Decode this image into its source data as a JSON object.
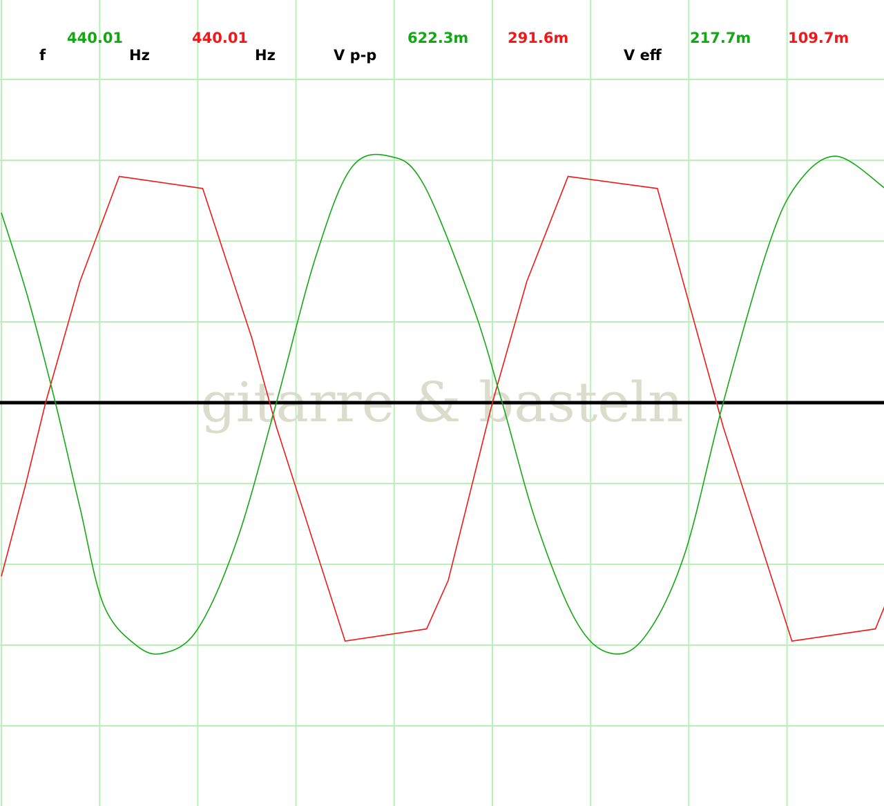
{
  "readouts": {
    "freq_label": "f",
    "freq_ch1": "440.01",
    "freq_unit_ch1": "Hz",
    "freq_ch2": "440.01",
    "freq_unit_ch2": "Hz",
    "vpp_label": "V p-p",
    "vpp_ch1": "622.3m",
    "vpp_ch2": "291.6m",
    "veff_label": "V eff",
    "veff_ch1": "217.7m",
    "veff_ch2": "109.7m"
  },
  "watermark": "gitarre & basteln",
  "colors": {
    "ch1": "#13a813",
    "ch2": "#f01818",
    "grid": "#b8f0b8",
    "zero_line": "#000000"
  },
  "chart_data": {
    "type": "line",
    "grid": true,
    "grid_divisions": {
      "x": 9,
      "y": 10
    },
    "x_unit": "division",
    "y_unit": "division",
    "xlim": [
      0,
      9
    ],
    "ylim": [
      -5,
      5
    ],
    "series": [
      {
        "color": "#13a813",
        "shape": "sine",
        "period_div": 4.55,
        "peak_div": 3.05,
        "trough_div": -3.1,
        "points": [
          [
            0,
            2.35
          ],
          [
            0.27,
            1.3
          ],
          [
            0.55,
            0.0
          ],
          [
            0.8,
            -1.3
          ],
          [
            1.04,
            -2.5
          ],
          [
            1.37,
            -3.0
          ],
          [
            1.65,
            -3.1
          ],
          [
            2.0,
            -2.8
          ],
          [
            2.4,
            -1.7
          ],
          [
            2.8,
            0.0
          ],
          [
            3.2,
            1.8
          ],
          [
            3.56,
            2.9
          ],
          [
            3.95,
            3.05
          ],
          [
            4.3,
            2.7
          ],
          [
            4.8,
            1.2
          ],
          [
            5.1,
            0.0
          ],
          [
            5.45,
            -1.5
          ],
          [
            5.85,
            -2.7
          ],
          [
            6.2,
            -3.1
          ],
          [
            6.55,
            -2.9
          ],
          [
            6.95,
            -1.9
          ],
          [
            7.35,
            0.0
          ],
          [
            7.8,
            1.9
          ],
          [
            8.1,
            2.7
          ],
          [
            8.5,
            3.05
          ],
          [
            9.0,
            2.65
          ]
        ]
      },
      {
        "color": "#f01818",
        "shape": "clipped-sine",
        "period_div": 4.55,
        "peak_div": 2.8,
        "trough_div": -2.95,
        "points": [
          [
            0,
            -2.15
          ],
          [
            0.25,
            -1.0
          ],
          [
            0.45,
            0.0
          ],
          [
            0.8,
            1.5
          ],
          [
            1.2,
            2.8
          ],
          [
            2.05,
            2.65
          ],
          [
            2.55,
            0.8
          ],
          [
            2.8,
            -0.3
          ],
          [
            3.5,
            -2.95
          ],
          [
            4.33,
            -2.8
          ],
          [
            4.55,
            -2.2
          ],
          [
            5.0,
            0.0
          ],
          [
            5.35,
            1.5
          ],
          [
            5.77,
            2.8
          ],
          [
            6.68,
            2.65
          ],
          [
            7.1,
            0.8
          ],
          [
            7.35,
            -0.3
          ],
          [
            8.05,
            -2.95
          ],
          [
            8.9,
            -2.8
          ],
          [
            9.0,
            -2.5
          ]
        ]
      }
    ]
  }
}
